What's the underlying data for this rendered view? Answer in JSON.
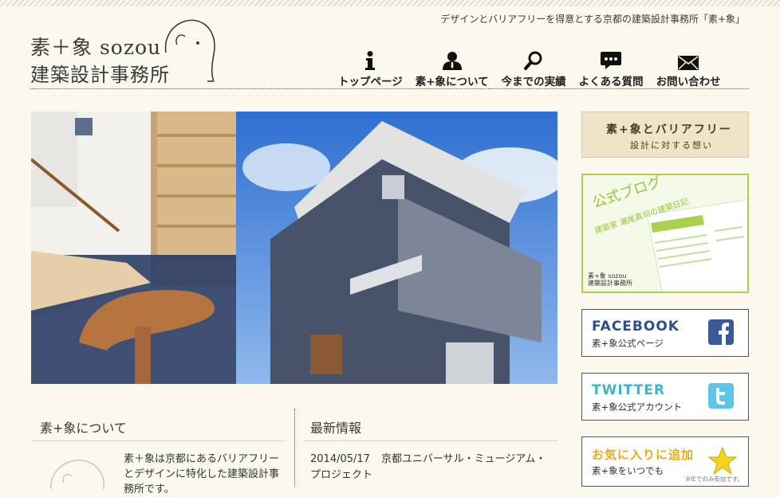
{
  "tagline": "デザインとバリアフリーを得意とする京都の建築設計事務所「素+象」",
  "logo": {
    "line1": "素＋象 sozou",
    "line2": "建築設計事務所"
  },
  "nav": [
    {
      "label": "トップページ",
      "icon": "info-icon"
    },
    {
      "label": "素+象について",
      "icon": "person-icon"
    },
    {
      "label": "今までの実績",
      "icon": "search-icon"
    },
    {
      "label": "よくある質問",
      "icon": "chat-icon"
    },
    {
      "label": "お問い合わせ",
      "icon": "mail-icon"
    }
  ],
  "sidebar": {
    "barrierfree": {
      "line1": "素+象とバリアフリー",
      "line2": "設計に対する想い"
    },
    "blog": {
      "title": "公式ブログ",
      "subtitle": "建築家 瀬尾真司の建築日記",
      "logo_line1": "素+象 sozou",
      "logo_line2": "建築設計事務所"
    },
    "facebook": {
      "title": "FACEBOOK",
      "subtitle": "素+象公式ページ",
      "color": "#2e4f8f"
    },
    "twitter": {
      "title": "TWITTER",
      "subtitle": "素+象公式アカウント",
      "color": "#3fb3c9"
    },
    "favorite": {
      "title": "お気に入りに追加",
      "subtitle": "素+象をいつでも",
      "note": "※IEでのみ有効です。",
      "color": "#e8a91a"
    }
  },
  "about": {
    "heading": "素+象について",
    "text": "素＋象は京都にあるバリアフリーとデザインに特化した建築設計事務所です。"
  },
  "news": {
    "heading": "最新情報",
    "items": [
      {
        "date": "2014/05/17",
        "title": "京都ユニバーサル・ミュージアム・プロジェクト"
      }
    ]
  }
}
